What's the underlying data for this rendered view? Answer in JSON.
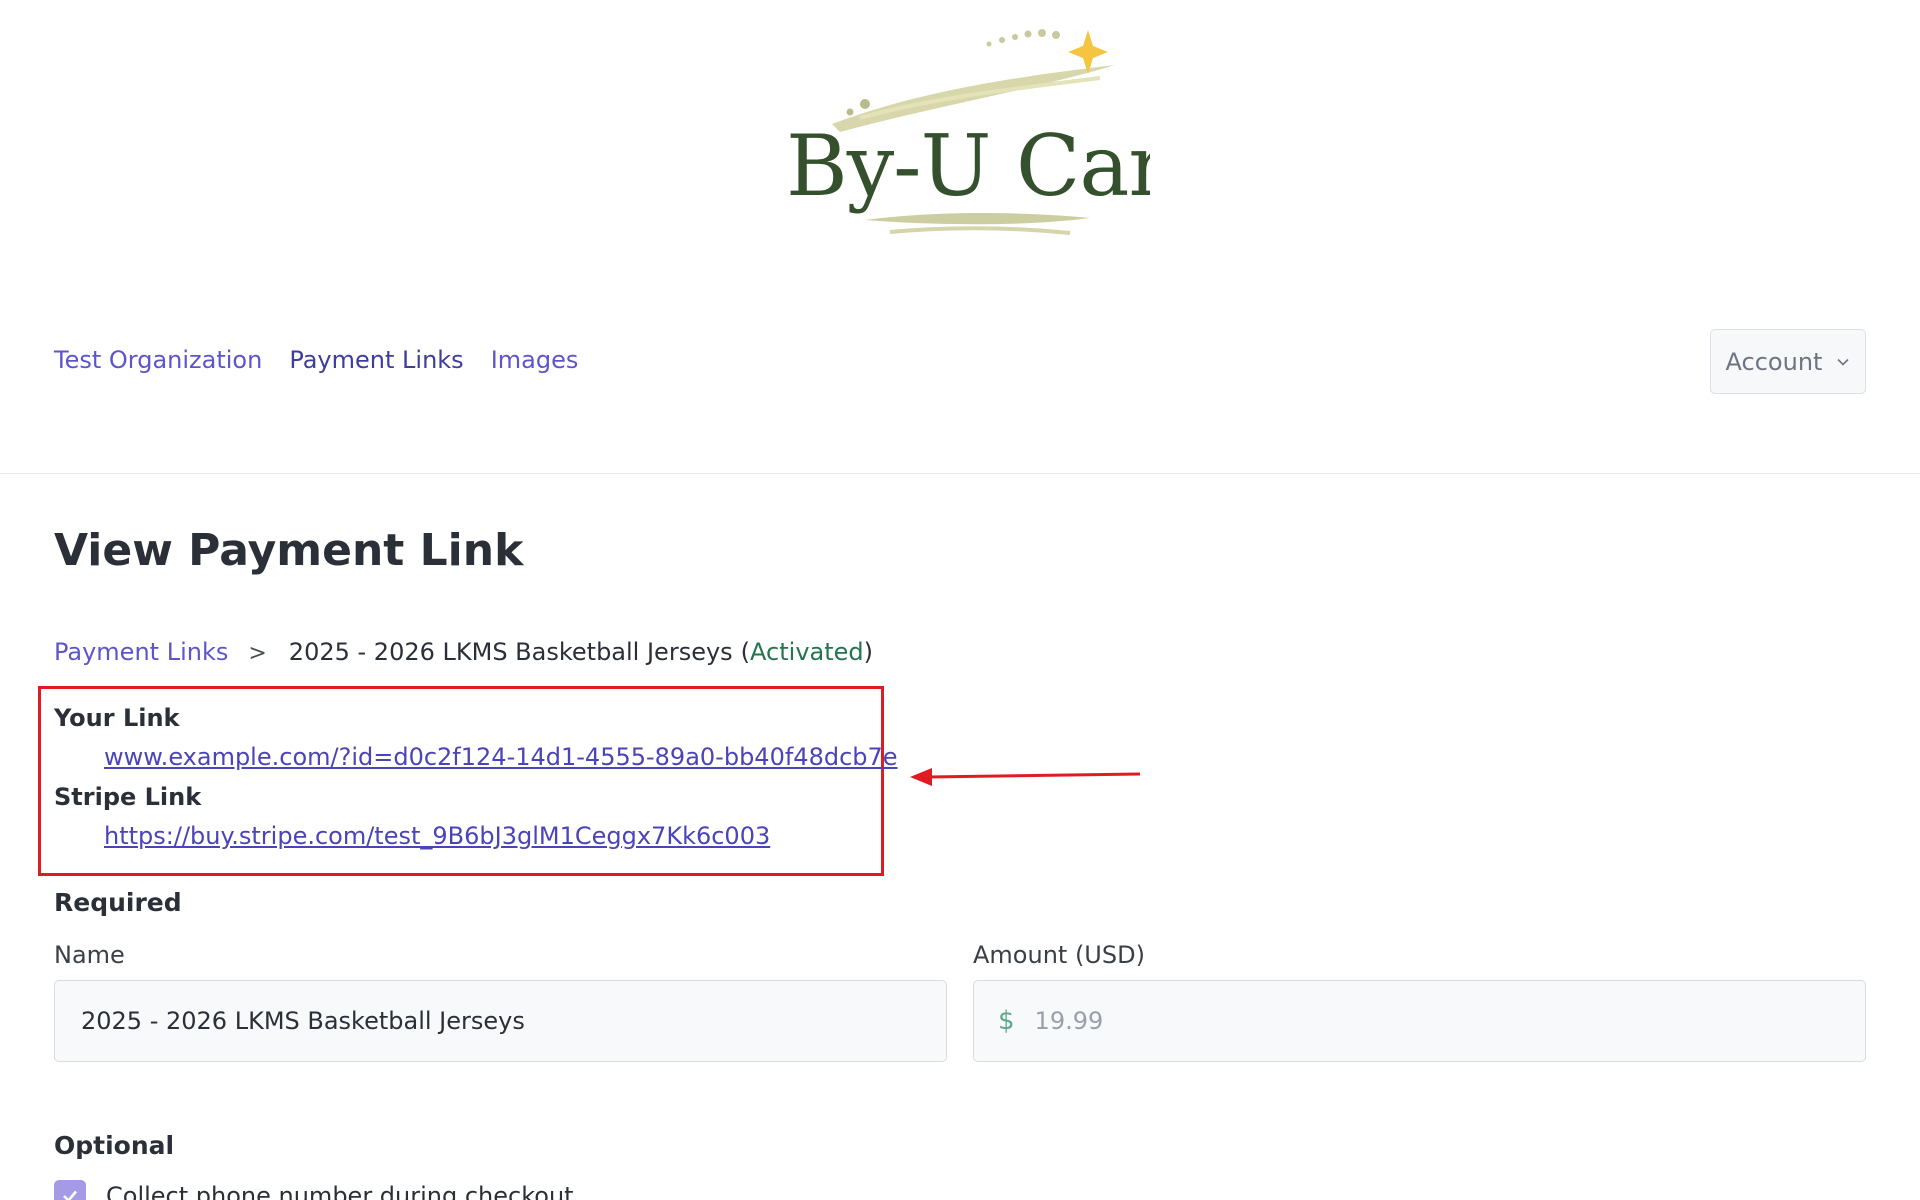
{
  "brand": {
    "name": "By-U Cart",
    "logo_text_color": "#34502c",
    "star_color": "#f5c542"
  },
  "nav": {
    "items": [
      {
        "label": "Test Organization"
      },
      {
        "label": "Payment Links"
      },
      {
        "label": "Images"
      }
    ],
    "active": "Payment Links"
  },
  "account": {
    "label": "Account",
    "icon": "chevron-down-icon"
  },
  "page": {
    "title": "View Payment Link"
  },
  "breadcrumb": {
    "root": "Payment Links",
    "separator": ">",
    "current": "2025 - 2026 LKMS Basketball Jerseys",
    "status_open": "(",
    "status": "Activated",
    "status_close": ")"
  },
  "links": {
    "your_link_label": "Your Link",
    "your_link_url": "www.example.com/?id=d0c2f124-14d1-4555-89a0-bb40f48dcb7e",
    "stripe_link_label": "Stripe Link",
    "stripe_link_url": "https://buy.stripe.com/test_9B6bJ3glM1Ceggx7Kk6c003"
  },
  "annotation": {
    "box_color": "#e01b22",
    "arrow_color": "#e01b22"
  },
  "required": {
    "heading": "Required",
    "name_label": "Name",
    "name_value": "2025 - 2026 LKMS Basketball Jerseys",
    "amount_label": "Amount (USD)",
    "currency_symbol": "$",
    "amount_value": "19.99"
  },
  "optional": {
    "heading": "Optional",
    "collect_phone_label": "Collect phone number during checkout",
    "collect_phone_checked": true
  },
  "colors": {
    "link": "#5e55c9",
    "activated": "#23754f",
    "checkbox": "#a49ae6"
  }
}
